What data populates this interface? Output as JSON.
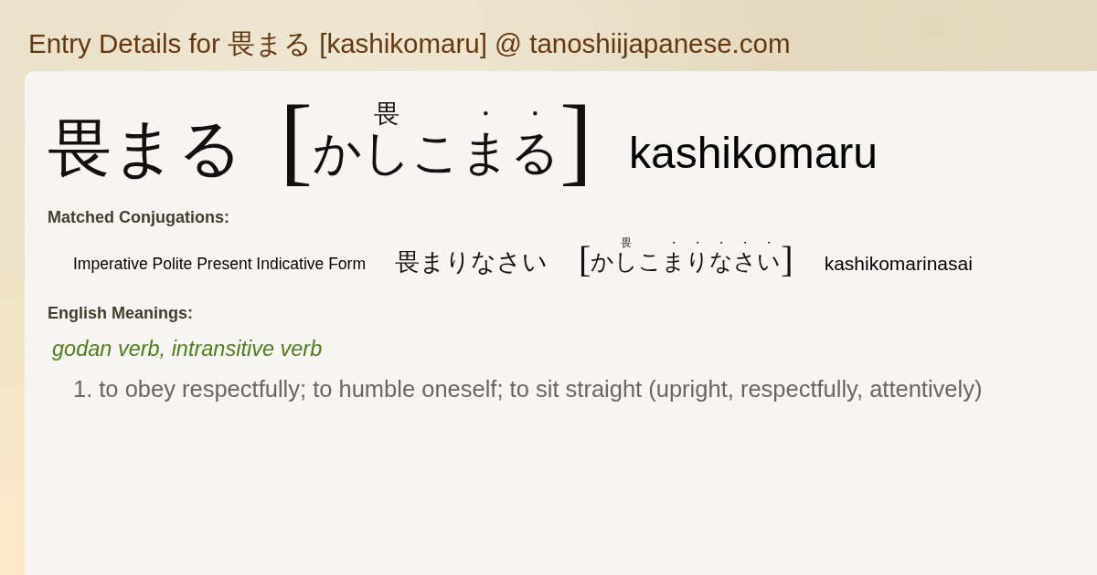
{
  "page_title": "Entry Details for 畏まる [kashikomaru] @ tanoshiijapanese.com",
  "entry": {
    "word": "畏まる",
    "reading": {
      "open": "[",
      "segments": [
        {
          "text": "かしこ",
          "ruby": "畏"
        },
        {
          "text": "ま",
          "ruby": "・"
        },
        {
          "text": "る",
          "ruby": "・"
        }
      ],
      "close": "]"
    },
    "romaji": "kashikomaru"
  },
  "matched_conjugations": {
    "heading": "Matched Conjugations:",
    "items": [
      {
        "form": "Imperative Polite Present Indicative Form",
        "word": "畏まりなさい",
        "reading": {
          "open": "[",
          "segments": [
            {
              "text": "かしこ",
              "ruby": "畏"
            },
            {
              "text": "ま",
              "ruby": "・"
            },
            {
              "text": "り",
              "ruby": "・"
            },
            {
              "text": "な",
              "ruby": "・"
            },
            {
              "text": "さ",
              "ruby": "・"
            },
            {
              "text": "い",
              "ruby": "・"
            }
          ],
          "close": "]"
        },
        "romaji": "kashikomarinasai"
      }
    ]
  },
  "english_meanings": {
    "heading": "English Meanings:",
    "groups": [
      {
        "part_of_speech": "godan verb, intransitive verb",
        "senses": [
          {
            "number": "1.",
            "text": "to obey respectfully; to humble oneself; to sit straight (upright, respectfully, attentively)"
          }
        ]
      }
    ]
  }
}
